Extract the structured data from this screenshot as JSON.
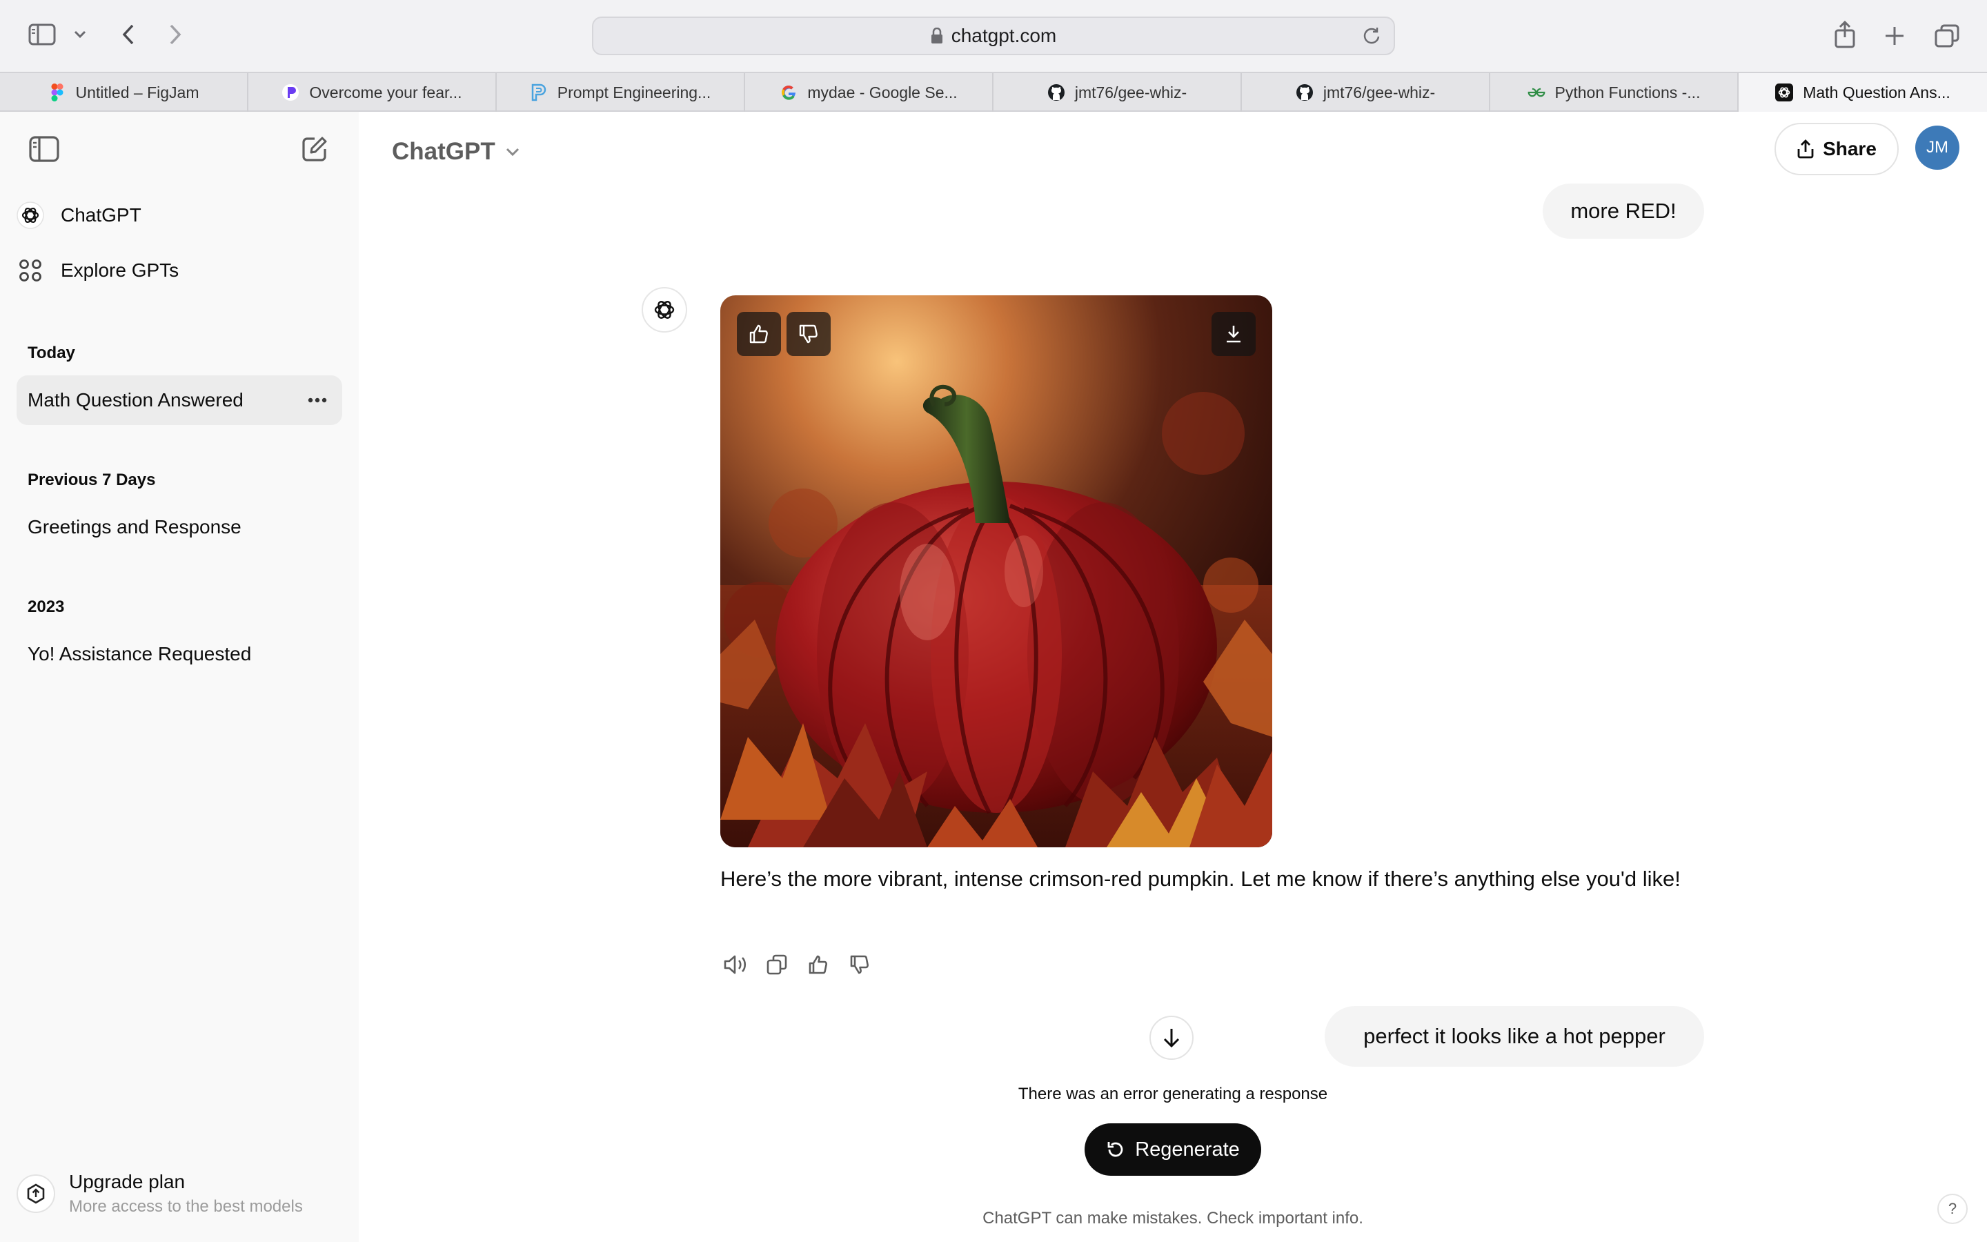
{
  "browser": {
    "url": "chatgpt.com",
    "tabs": [
      {
        "title": "Untitled – FigJam",
        "icon": "figma-icon"
      },
      {
        "title": "Overcome your fear...",
        "icon": "perplexity-icon"
      },
      {
        "title": "Prompt Engineering...",
        "icon": "prompt-icon"
      },
      {
        "title": "mydae - Google Se...",
        "icon": "google-icon"
      },
      {
        "title": "jmt76/gee-whiz-",
        "icon": "github-icon"
      },
      {
        "title": "jmt76/gee-whiz-",
        "icon": "github-icon"
      },
      {
        "title": "Python Functions -...",
        "icon": "geeksforgeeks-icon"
      },
      {
        "title": "Math Question Ans...",
        "icon": "openai-icon"
      }
    ]
  },
  "sidebar": {
    "nav": [
      {
        "label": "ChatGPT",
        "icon": "openai-icon"
      },
      {
        "label": "Explore GPTs",
        "icon": "grid-icon"
      }
    ],
    "sections": [
      {
        "heading": "Today",
        "items": [
          "Math Question Answered"
        ]
      },
      {
        "heading": "Previous 7 Days",
        "items": [
          "Greetings and Response"
        ]
      },
      {
        "heading": "2023",
        "items": [
          "Yo! Assistance Requested"
        ]
      }
    ],
    "upgrade": {
      "title": "Upgrade plan",
      "subtitle": "More access to the best models"
    }
  },
  "header": {
    "model": "ChatGPT",
    "share_label": "Share",
    "avatar_initials": "JM"
  },
  "conversation": {
    "user_message_1": "more RED!",
    "assistant_reply": "Here’s the more vibrant, intense crimson-red pumpkin. Let me know if there’s anything else you'd like!",
    "user_message_2": "perfect it looks like a hot pepper",
    "error_text": "There was an error generating a response",
    "regenerate_label": "Regenerate"
  },
  "footer": {
    "disclaimer": "ChatGPT can make mistakes. Check important info.",
    "help": "?"
  },
  "colors": {
    "sidebar_bg": "#f9f9f9",
    "bubble_bg": "#f4f4f4",
    "avatar_bg": "#3d7ab8",
    "regenerate_bg": "#0d0d0d"
  }
}
